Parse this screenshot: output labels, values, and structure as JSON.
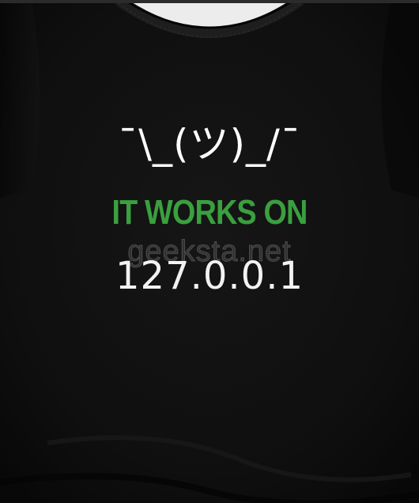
{
  "shirt": {
    "print_lines": {
      "shrug": "¯\\_(ツ)_/¯",
      "headline": "IT WORKS ON",
      "address": "127.0.0.1"
    },
    "watermark": "geeksta.net"
  },
  "colors": {
    "background": "#ececec",
    "shirt_fabric": "#111111",
    "headline_green": "#3aa03f",
    "print_white": "#f2f2f2"
  }
}
